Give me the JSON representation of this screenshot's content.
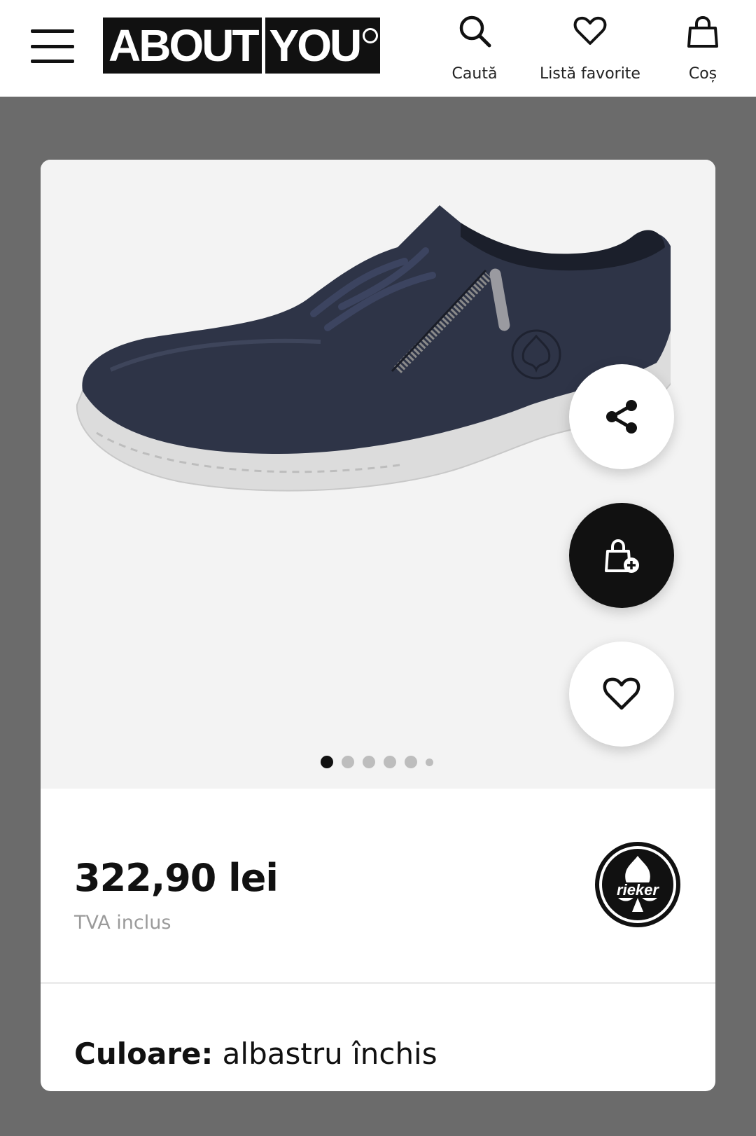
{
  "header": {
    "logo_left": "ABOUT",
    "logo_right": "YOU",
    "nav": {
      "search_label": "Caută",
      "favorites_label": "Listă favorite",
      "cart_label": "Coș"
    }
  },
  "product": {
    "price": "322,90 lei",
    "vat_note": "TVA inclus",
    "brand": "rieker",
    "color_label": "Culoare:",
    "color_value": "albastru închis",
    "gallery": {
      "current_image": 1,
      "image_count": 6
    }
  },
  "colors": {
    "page_bg": "#6b6b6b",
    "shoe": "#2e3447",
    "accent": "#111111"
  },
  "icons": [
    "menu-icon",
    "search-icon",
    "heart-icon",
    "bag-icon",
    "share-icon",
    "bag-add-icon"
  ]
}
